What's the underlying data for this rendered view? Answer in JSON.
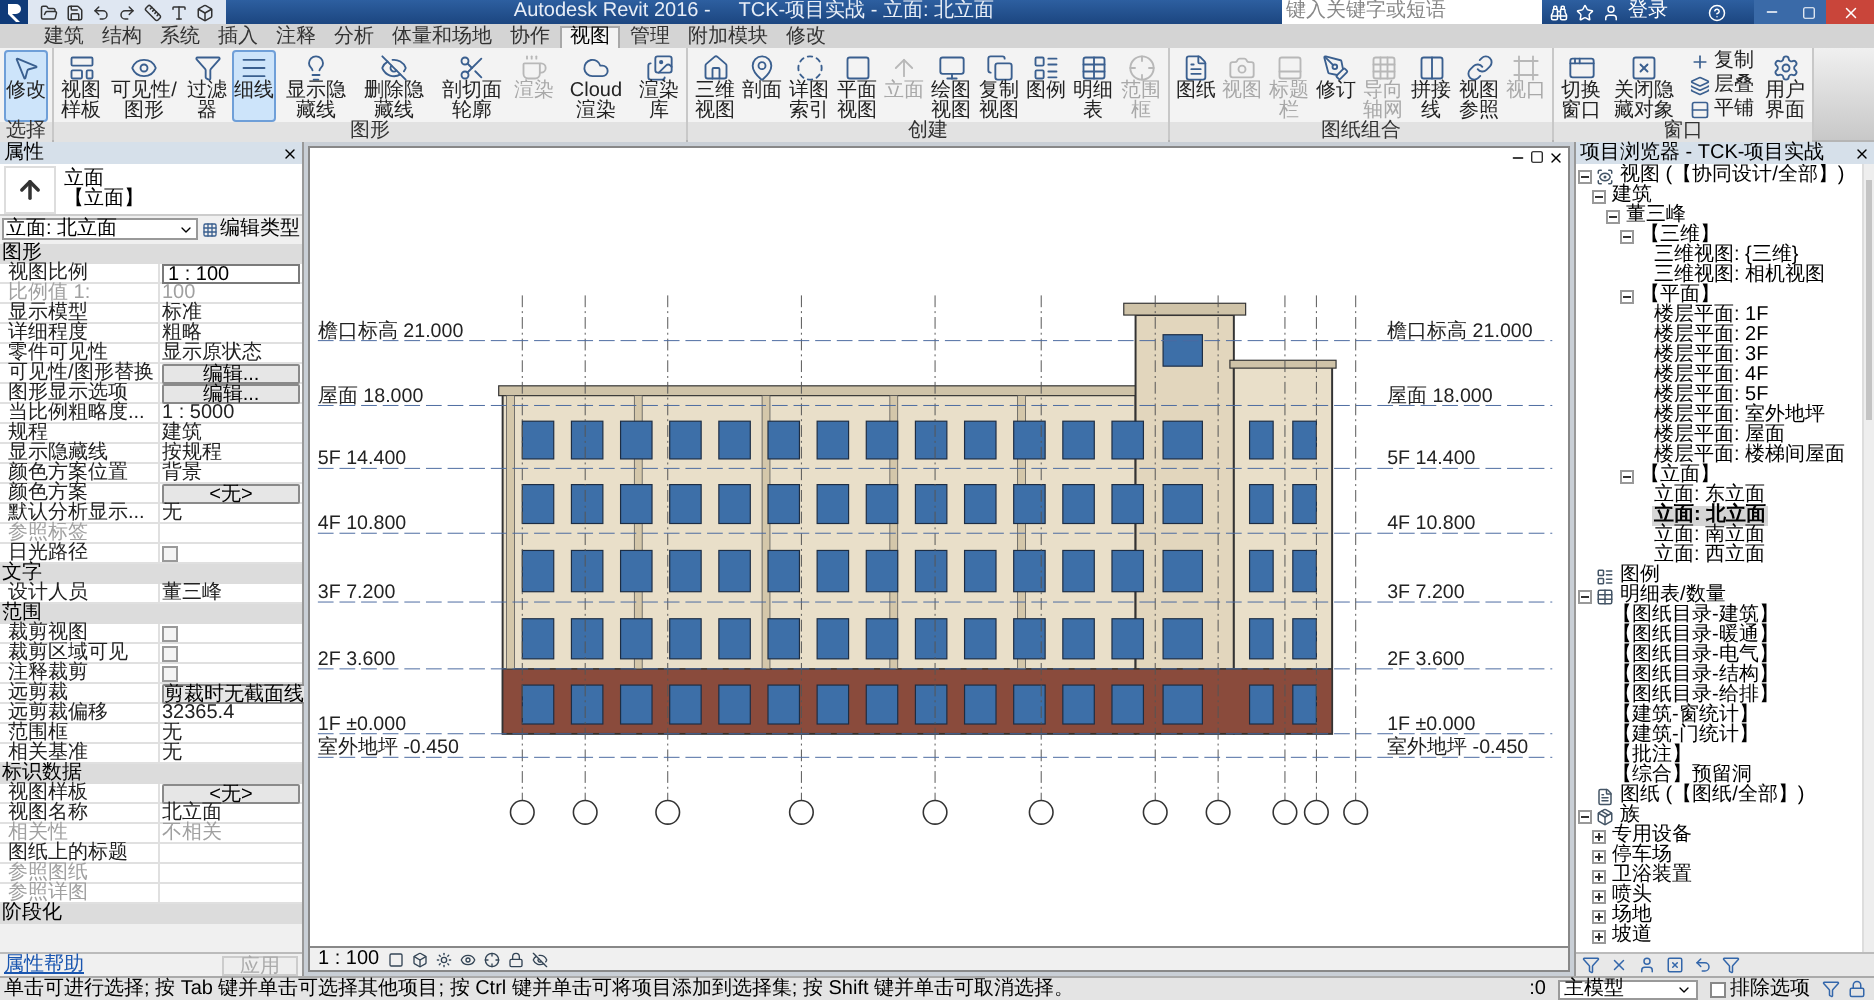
{
  "title_bar": {
    "app_title": "Autodesk Revit 2016 -",
    "doc_title": "TCK-项目实战 - 立面: 北立面",
    "search": {
      "placeholder": "键入关键字或短语"
    },
    "sign_in": "登录"
  },
  "tabs": [
    {
      "label": "建筑",
      "selected": false
    },
    {
      "label": "结构",
      "selected": false
    },
    {
      "label": "系统",
      "selected": false
    },
    {
      "label": "插入",
      "selected": false
    },
    {
      "label": "注释",
      "selected": false
    },
    {
      "label": "分析",
      "selected": false
    },
    {
      "label": "体量和场地",
      "selected": false
    },
    {
      "label": "协作",
      "selected": false
    },
    {
      "label": "视图",
      "selected": true
    },
    {
      "label": "管理",
      "selected": false
    },
    {
      "label": "附加模块",
      "selected": false
    },
    {
      "label": "修改",
      "selected": false
    }
  ],
  "ribbon_panels": [
    {
      "label": "选择",
      "buttons": [
        {
          "label": "修改",
          "kind": "large",
          "selected": true,
          "disabled": false
        }
      ]
    },
    {
      "label": "图形",
      "buttons": [
        {
          "label": "视图样板",
          "kind": "large",
          "selected": false,
          "disabled": false
        },
        {
          "label": "可见性/图形",
          "kind": "large",
          "selected": false,
          "disabled": false
        },
        {
          "label": "过滤器",
          "kind": "large",
          "selected": false,
          "disabled": false
        },
        {
          "label": "细线",
          "kind": "large",
          "selected": true,
          "disabled": false
        },
        {
          "label": "显示隐藏线",
          "kind": "large",
          "selected": false,
          "disabled": false
        },
        {
          "label": "删除隐藏线",
          "kind": "large",
          "selected": false,
          "disabled": false
        },
        {
          "label": "剖切面轮廓",
          "kind": "large",
          "selected": false,
          "disabled": false
        },
        {
          "label": "渲染",
          "kind": "large",
          "selected": false,
          "disabled": true
        },
        {
          "label": "Cloud 渲染",
          "kind": "large",
          "selected": false,
          "disabled": false
        },
        {
          "label": "渲染库",
          "kind": "large",
          "selected": false,
          "disabled": false
        }
      ]
    },
    {
      "label": "创建",
      "buttons": [
        {
          "label": "三维视图",
          "kind": "large",
          "selected": false,
          "disabled": false
        },
        {
          "label": "剖面",
          "kind": "large",
          "selected": false,
          "disabled": false
        },
        {
          "label": "详图索引",
          "kind": "large",
          "selected": false,
          "disabled": false
        },
        {
          "label": "平面视图",
          "kind": "large",
          "selected": false,
          "disabled": false
        },
        {
          "label": "立面",
          "kind": "large",
          "selected": false,
          "disabled": true
        },
        {
          "label": "绘图视图",
          "kind": "large",
          "selected": false,
          "disabled": false
        },
        {
          "label": "复制视图",
          "kind": "large",
          "selected": false,
          "disabled": false
        },
        {
          "label": "图例",
          "kind": "large",
          "selected": false,
          "disabled": false
        },
        {
          "label": "明细表",
          "kind": "large",
          "selected": false,
          "disabled": false
        },
        {
          "label": "范围框",
          "kind": "large",
          "selected": false,
          "disabled": true
        }
      ]
    },
    {
      "label": "图纸组合",
      "buttons": [
        {
          "label": "图纸",
          "kind": "large",
          "selected": false,
          "disabled": false
        },
        {
          "label": "视图",
          "kind": "large",
          "selected": false,
          "disabled": true
        },
        {
          "label": "标题栏",
          "kind": "large",
          "selected": false,
          "disabled": true
        },
        {
          "label": "修订",
          "kind": "large",
          "selected": false,
          "disabled": false
        },
        {
          "label": "导向轴网",
          "kind": "large",
          "selected": false,
          "disabled": true
        },
        {
          "label": "拼接线",
          "kind": "large",
          "selected": false,
          "disabled": false
        },
        {
          "label": "视图参照",
          "kind": "large",
          "selected": false,
          "disabled": false
        },
        {
          "label": "视口",
          "kind": "large",
          "selected": false,
          "disabled": true
        }
      ]
    },
    {
      "label": "窗口",
      "buttons": [
        {
          "label": "切换窗口",
          "kind": "large",
          "selected": false,
          "disabled": false
        },
        {
          "label": "关闭隐藏对象",
          "kind": "large",
          "selected": false,
          "disabled": false
        },
        {
          "label": "复制",
          "kind": "small",
          "selected": false,
          "disabled": false
        },
        {
          "label": "层叠",
          "kind": "small",
          "selected": false,
          "disabled": false
        },
        {
          "label": "平铺",
          "kind": "small",
          "selected": false,
          "disabled": false
        },
        {
          "label": "用户界面",
          "kind": "large",
          "selected": false,
          "disabled": false
        }
      ]
    }
  ],
  "properties": {
    "title": "属性",
    "type_name": "立面",
    "type_family": "【立面】",
    "instance_selector": "立面: 北立面",
    "edit_type": "编辑类型",
    "groups": [
      {
        "name": "图形",
        "rows": [
          {
            "label": "视图比例",
            "value": "1 : 100",
            "kind": "field",
            "disabled": false
          },
          {
            "label": "比例值 1:",
            "value": "100",
            "kind": "text",
            "disabled": true
          },
          {
            "label": "显示模型",
            "value": "标准",
            "kind": "text",
            "disabled": false
          },
          {
            "label": "详细程度",
            "value": "粗略",
            "kind": "text",
            "disabled": false
          },
          {
            "label": "零件可见性",
            "value": "显示原状态",
            "kind": "text",
            "disabled": false
          },
          {
            "label": "可见性/图形替换",
            "value": "编辑...",
            "kind": "button",
            "disabled": false
          },
          {
            "label": "图形显示选项",
            "value": "编辑...",
            "kind": "button",
            "disabled": false
          },
          {
            "label": "当比例粗略度...",
            "value": "1 : 5000",
            "kind": "text",
            "disabled": false
          },
          {
            "label": "规程",
            "value": "建筑",
            "kind": "text",
            "disabled": false
          },
          {
            "label": "显示隐藏线",
            "value": "按规程",
            "kind": "text",
            "disabled": false
          },
          {
            "label": "颜色方案位置",
            "value": "背景",
            "kind": "text",
            "disabled": false
          },
          {
            "label": "颜色方案",
            "value": "<无>",
            "kind": "button",
            "disabled": false
          },
          {
            "label": "默认分析显示...",
            "value": "无",
            "kind": "text",
            "disabled": false
          },
          {
            "label": "参照标签",
            "kind": "text",
            "disabled": true
          },
          {
            "label": "日光路径",
            "kind": "checkbox",
            "checked": false,
            "disabled": false
          }
        ]
      },
      {
        "name": "文字",
        "rows": [
          {
            "label": "设计人员",
            "value": "董三峰",
            "kind": "text",
            "disabled": false
          }
        ]
      },
      {
        "name": "范围",
        "rows": [
          {
            "label": "裁剪视图",
            "kind": "checkbox",
            "checked": false,
            "disabled": false
          },
          {
            "label": "裁剪区域可见",
            "kind": "checkbox",
            "checked": false,
            "disabled": false
          },
          {
            "label": "注释裁剪",
            "kind": "checkbox",
            "checked": false,
            "disabled": false
          },
          {
            "label": "远剪裁",
            "value": "剪裁时无截面线",
            "kind": "button",
            "disabled": false
          },
          {
            "label": "远剪裁偏移",
            "value": "32365.4",
            "kind": "text",
            "disabled": false
          },
          {
            "label": "范围框",
            "value": "无",
            "kind": "text",
            "disabled": false
          },
          {
            "label": "相关基准",
            "value": "无",
            "kind": "text",
            "disabled": false
          }
        ]
      },
      {
        "name": "标识数据",
        "rows": [
          {
            "label": "视图样板",
            "value": "<无>",
            "kind": "button",
            "disabled": false
          },
          {
            "label": "视图名称",
            "value": "北立面",
            "kind": "text",
            "disabled": false
          },
          {
            "label": "相关性",
            "value": "不相关",
            "kind": "text",
            "disabled": true
          },
          {
            "label": "图纸上的标题",
            "kind": "text",
            "disabled": false
          },
          {
            "label": "参照图纸",
            "kind": "text",
            "disabled": true
          },
          {
            "label": "参照详图",
            "kind": "text",
            "disabled": true
          }
        ]
      },
      {
        "name": "阶段化"
      }
    ],
    "help_link": "属性帮助",
    "apply": {
      "label": "应用",
      "disabled": true
    }
  },
  "drawing": {
    "levels": [
      {
        "left": {
          "name": "檐口标高",
          "elevation": "21.000"
        },
        "right": {
          "name": "檐口标高",
          "elevation": "21.000"
        }
      },
      {
        "left": {
          "name": "屋面",
          "elevation": "18.000"
        },
        "right": {
          "name": "屋面",
          "elevation": "18.000"
        }
      },
      {
        "left": {
          "name": "5F",
          "elevation": "14.400"
        },
        "right": {
          "name": "5F",
          "elevation": "14.400"
        }
      },
      {
        "left": {
          "name": "4F",
          "elevation": "10.800"
        },
        "right": {
          "name": "4F",
          "elevation": "10.800"
        }
      },
      {
        "left": {
          "name": "3F",
          "elevation": "7.200"
        },
        "right": {
          "name": "3F",
          "elevation": "7.200"
        }
      },
      {
        "left": {
          "name": "2F",
          "elevation": "3.600"
        },
        "right": {
          "name": "2F",
          "elevation": "3.600"
        }
      },
      {
        "left": {
          "name": "1F",
          "elevation": "±0.000"
        },
        "right": {
          "name": "1F",
          "elevation": "±0.000"
        }
      },
      {
        "left": {
          "name": "室外地坪",
          "elevation": "-0.450"
        },
        "right": {
          "name": "室外地坪",
          "elevation": "-0.450"
        }
      }
    ],
    "scale": "1 : 100"
  },
  "browser": {
    "title": "项目浏览器 - TCK-项目实战",
    "tree": [
      {
        "label": "视图 (【协同设计/全部】)",
        "expanded": true,
        "selected": false,
        "children": [
          {
            "label": "建筑",
            "expanded": true,
            "selected": false,
            "children": [
              {
                "label": "董三峰",
                "expanded": true,
                "selected": false,
                "children": [
                  {
                    "label": "【三维】",
                    "expanded": true,
                    "selected": false,
                    "children": [
                      {
                        "label": "三维视图: {三维}",
                        "selected": false
                      },
                      {
                        "label": "三维视图: 相机视图",
                        "selected": false
                      }
                    ]
                  },
                  {
                    "label": "【平面】",
                    "expanded": true,
                    "selected": false,
                    "children": [
                      {
                        "label": "楼层平面: 1F",
                        "selected": false
                      },
                      {
                        "label": "楼层平面: 2F",
                        "selected": false
                      },
                      {
                        "label": "楼层平面: 3F",
                        "selected": false
                      },
                      {
                        "label": "楼层平面: 4F",
                        "selected": false
                      },
                      {
                        "label": "楼层平面: 5F",
                        "selected": false
                      },
                      {
                        "label": "楼层平面: 室外地坪",
                        "selected": false
                      },
                      {
                        "label": "楼层平面: 屋面",
                        "selected": false
                      },
                      {
                        "label": "楼层平面: 楼梯间屋面",
                        "selected": false
                      }
                    ]
                  },
                  {
                    "label": "【立面】",
                    "expanded": true,
                    "selected": false,
                    "children": [
                      {
                        "label": "立面: 东立面",
                        "selected": false
                      },
                      {
                        "label": "立面: 北立面",
                        "selected": true
                      },
                      {
                        "label": "立面: 南立面",
                        "selected": false
                      },
                      {
                        "label": "立面: 西立面",
                        "selected": false
                      }
                    ]
                  }
                ]
              }
            ]
          }
        ]
      },
      {
        "label": "图例",
        "selected": false
      },
      {
        "label": "明细表/数量",
        "expanded": true,
        "selected": false,
        "children": [
          {
            "label": "【图纸目录-建筑】",
            "selected": false
          },
          {
            "label": "【图纸目录-暖通】",
            "selected": false
          },
          {
            "label": "【图纸目录-电气】",
            "selected": false
          },
          {
            "label": "【图纸目录-结构】",
            "selected": false
          },
          {
            "label": "【图纸目录-给排】",
            "selected": false
          },
          {
            "label": "【建筑-窗统计】",
            "selected": false
          },
          {
            "label": "【建筑-门统计】",
            "selected": false
          },
          {
            "label": "【批注】",
            "selected": false
          },
          {
            "label": "【综合】预留洞",
            "selected": false
          }
        ]
      },
      {
        "label": "图纸 (【图纸/全部】)",
        "selected": false
      },
      {
        "label": "族",
        "expanded": true,
        "selected": false,
        "children": [
          {
            "label": "专用设备",
            "expanded": false,
            "selected": false
          },
          {
            "label": "停车场",
            "expanded": false,
            "selected": false
          },
          {
            "label": "卫浴装置",
            "expanded": false,
            "selected": false
          },
          {
            "label": "喷头",
            "expanded": false,
            "selected": false
          },
          {
            "label": "场地",
            "expanded": false,
            "selected": false
          },
          {
            "label": "坡道",
            "expanded": false,
            "selected": false
          }
        ]
      }
    ]
  },
  "status_bar": {
    "hint": "单击可进行选择; 按 Tab 键并单击可选择其他项目; 按 Ctrl 键并单击可将项目添加到选择集; 按 Shift 键并单击可取消选择。",
    "workset": ":0",
    "model": "主模型",
    "exclude_option": {
      "label": "排除选项",
      "checked": false
    }
  }
}
